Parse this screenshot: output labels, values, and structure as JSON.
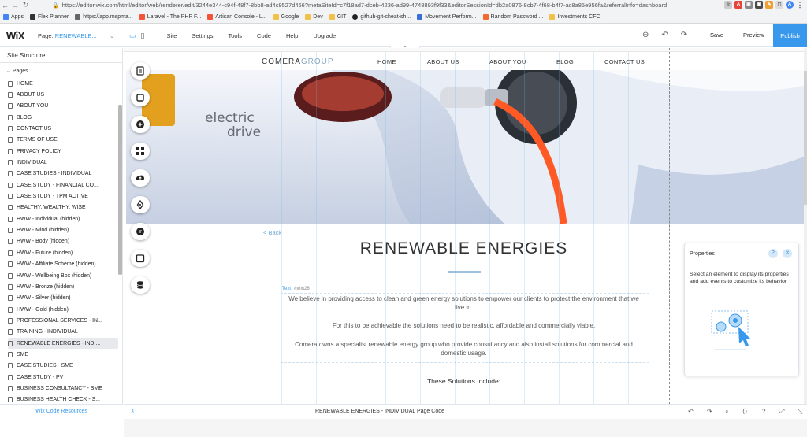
{
  "browser": {
    "url": "https://editor.wix.com/html/editor/web/renderer/edit/3244e344-c94f-48f7-8bb8-ad4c9527d466?metaSiteId=c7f18ad7-dceb-4236-ad99-4748893f9f33&editorSessionId=db2a0876-8cb7-4f68-b4f7-ac8a85e956fa&referralInfo=dashboard",
    "bookmarks": [
      "Apps",
      "Flex Planner",
      "https://app.mspma...",
      "Laravel - The PHP F...",
      "Artisan Console - L...",
      "Google",
      "Dev",
      "GIT",
      "github-git-cheat-sh...",
      "Movement Perform...",
      "Random Password ...",
      "Investments CFC"
    ],
    "profile_initial": "A"
  },
  "editor": {
    "logo": "WiX",
    "page_label": "Page:",
    "page_value": "RENEWABLE...",
    "menu": [
      "Site",
      "Settings",
      "Tools",
      "Code",
      "Help",
      "Upgrade"
    ],
    "save": "Save",
    "preview": "Preview",
    "publish": "Publish"
  },
  "sidebar": {
    "title": "Site Structure",
    "root": "Pages",
    "pages": [
      "HOME",
      "ABOUT US",
      "ABOUT YOU",
      "BLOG",
      "CONTACT US",
      "TERMS OF USE",
      "PRIVACY POLICY",
      "INDIVIDUAL",
      "CASE STUDIES - INDIVIDUAL",
      "CASE STUDY - FINANCIAL CO...",
      "CASE STUDY - TPM ACTIVE",
      "HEALTHY, WEALTHY, WISE",
      "HWW - Individual (hidden)",
      "HWW - Mind (hidden)",
      "HWW - Body (hidden)",
      "HWW - Future (hidden)",
      "HWW - Affiliate Scheme (hidden)",
      "HWW - Wellbeing Box (hidden)",
      "HWW - Bronze (hidden)",
      "HWW - Silver (hidden)",
      "HWW - Gold (hidden)",
      "PROFESSIONAL SERVICES - IN...",
      "TRAINING - INDIVIDUAL",
      "RENEWABLE ENERGIES - INDI...",
      "SME",
      "CASE STUDIES - SME",
      "CASE STUDY - PV",
      "BUSINESS CONSULTANCY - SME",
      "BUSINESS HEALTH CHECK - S..."
    ],
    "selected_index": 23,
    "code_resources": "Wix Code Resources"
  },
  "site": {
    "brand_a": "COMERA",
    "brand_b": "GROUP",
    "nav": [
      "HOME",
      "ABOUT US",
      "ABOUT YOU",
      "BLOG",
      "CONTACT US"
    ],
    "hero_text_1": "electric",
    "hero_text_2": "drive",
    "back": "< Back",
    "heading": "RENEWABLE ENERGIES",
    "text_tag": "Text",
    "text_id": "#text26",
    "para1": "We believe in providing access to clean and green energy solutions to empower our clients to protect the environment that we live in.",
    "para2": "For this to be achievable the solutions need to be realistic, affordable and commercially viable.",
    "para3": "Comera owns a specialist renewable energy group who provide consultancy and also install solutions for commercial and domestic usage.",
    "solutions": "These Solutions Include:"
  },
  "properties": {
    "title": "Properties",
    "help": "?",
    "close": "✕",
    "text": "Select an element to display its properties and add events to customize its behavior"
  },
  "bottom": {
    "label": "RENEWABLE ENERGIES - INDIVIDUAL Page Code"
  },
  "colors": {
    "accent": "#3899ec",
    "cable": "#ff5a26",
    "sky": "#d2dbea"
  }
}
